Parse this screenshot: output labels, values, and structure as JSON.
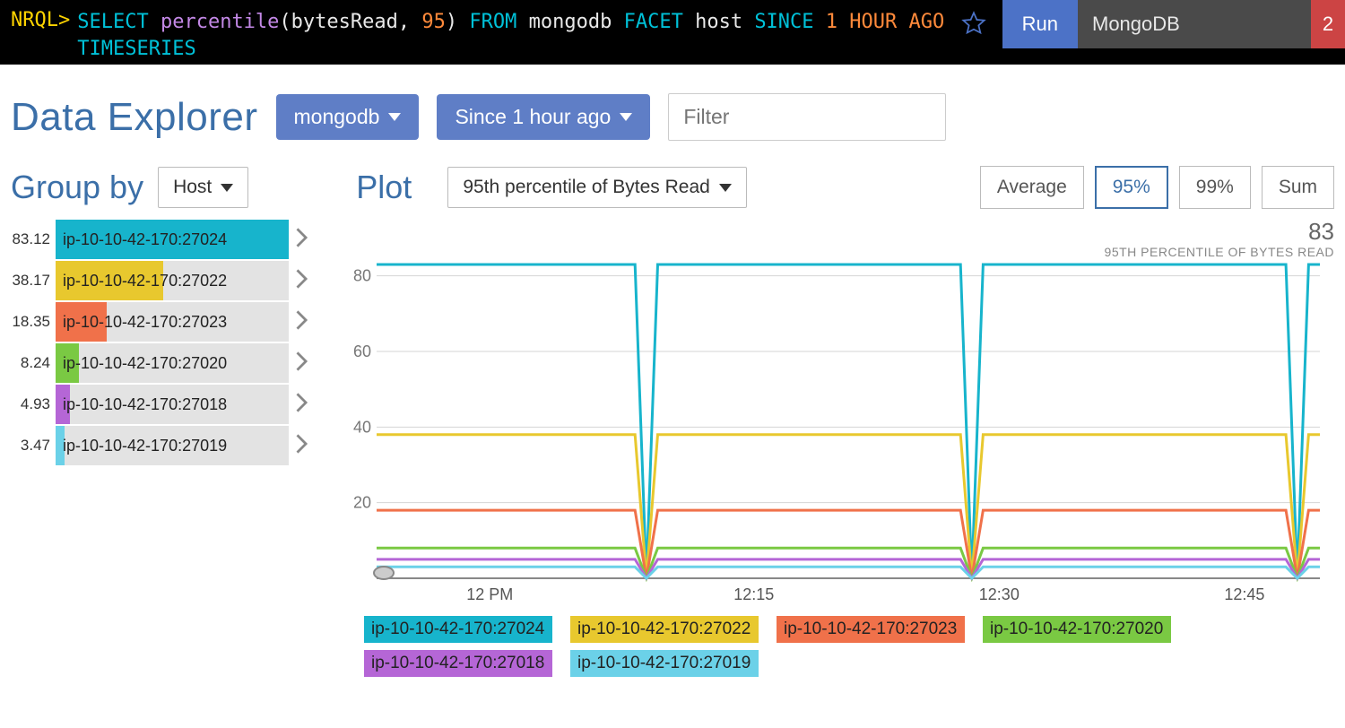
{
  "nrql": {
    "prompt": "NRQL>",
    "tokens": [
      {
        "t": "SELECT",
        "c": "kw"
      },
      {
        "t": " "
      },
      {
        "t": "percentile",
        "c": "fn"
      },
      {
        "t": "(",
        "c": "id"
      },
      {
        "t": "bytesRead",
        "c": "id"
      },
      {
        "t": ", ",
        "c": "id"
      },
      {
        "t": "95",
        "c": "num"
      },
      {
        "t": ")",
        "c": "id"
      },
      {
        "t": " "
      },
      {
        "t": "FROM",
        "c": "kw"
      },
      {
        "t": " "
      },
      {
        "t": "mongodb",
        "c": "id"
      },
      {
        "t": " "
      },
      {
        "t": "FACET",
        "c": "kw"
      },
      {
        "t": " "
      },
      {
        "t": "host",
        "c": "id"
      },
      {
        "t": " "
      },
      {
        "t": "SINCE",
        "c": "kw"
      },
      {
        "t": " "
      },
      {
        "t": "1",
        "c": "num"
      },
      {
        "t": " "
      },
      {
        "t": "HOUR",
        "c": "num"
      },
      {
        "t": " "
      },
      {
        "t": "AGO",
        "c": "num"
      },
      {
        "t": "\n"
      },
      {
        "t": "TIMESERIES",
        "c": "kw"
      }
    ],
    "run_label": "Run",
    "app_tab": "MongoDB",
    "badge_count": "2"
  },
  "header": {
    "title": "Data Explorer",
    "source_dd": "mongodb",
    "time_dd": "Since 1 hour ago",
    "filter_placeholder": "Filter"
  },
  "group": {
    "label": "Group by",
    "dd": "Host"
  },
  "plot": {
    "label": "Plot",
    "dd": "95th percentile of Bytes Read",
    "agg": [
      "Average",
      "95%",
      "99%",
      "Sum"
    ],
    "agg_active": "95%"
  },
  "hosts": [
    {
      "value": "83.12",
      "name": "ip-10-10-42-170:27024",
      "color": "#17b4cc",
      "pct": 100
    },
    {
      "value": "38.17",
      "name": "ip-10-10-42-170:27022",
      "color": "#e8c82e",
      "pct": 46
    },
    {
      "value": "18.35",
      "name": "ip-10-10-42-170:27023",
      "color": "#f0714a",
      "pct": 22
    },
    {
      "value": "8.24",
      "name": "ip-10-10-42-170:27020",
      "color": "#7ac943",
      "pct": 10
    },
    {
      "value": "4.93",
      "name": "ip-10-10-42-170:27018",
      "color": "#b566d6",
      "pct": 6
    },
    {
      "value": "3.47",
      "name": "ip-10-10-42-170:27019",
      "color": "#6bd1e8",
      "pct": 4
    }
  ],
  "chart_data": {
    "type": "line",
    "title": "",
    "subtitle": "95TH PERCENTILE OF BYTES READ",
    "max_label": "83",
    "ylim": [
      0,
      83
    ],
    "y_ticks": [
      20,
      40,
      60,
      80
    ],
    "x_ticks": [
      {
        "pos": 0.12,
        "label": "12 PM"
      },
      {
        "pos": 0.4,
        "label": "12:15"
      },
      {
        "pos": 0.66,
        "label": "12:30"
      },
      {
        "pos": 0.92,
        "label": "12:45"
      }
    ],
    "dips_x": [
      0.286,
      0.631,
      0.976
    ],
    "series": [
      {
        "name": "ip-10-10-42-170:27024",
        "color": "#17b4cc",
        "baseline": 83
      },
      {
        "name": "ip-10-10-42-170:27022",
        "color": "#e8c82e",
        "baseline": 38
      },
      {
        "name": "ip-10-10-42-170:27023",
        "color": "#f0714a",
        "baseline": 18
      },
      {
        "name": "ip-10-10-42-170:27020",
        "color": "#7ac943",
        "baseline": 8
      },
      {
        "name": "ip-10-10-42-170:27018",
        "color": "#b566d6",
        "baseline": 5
      },
      {
        "name": "ip-10-10-42-170:27019",
        "color": "#6bd1e8",
        "baseline": 3
      }
    ]
  },
  "legend_order": [
    "ip-10-10-42-170:27024",
    "ip-10-10-42-170:27022",
    "ip-10-10-42-170:27023",
    "ip-10-10-42-170:27020",
    "ip-10-10-42-170:27018",
    "ip-10-10-42-170:27019"
  ]
}
